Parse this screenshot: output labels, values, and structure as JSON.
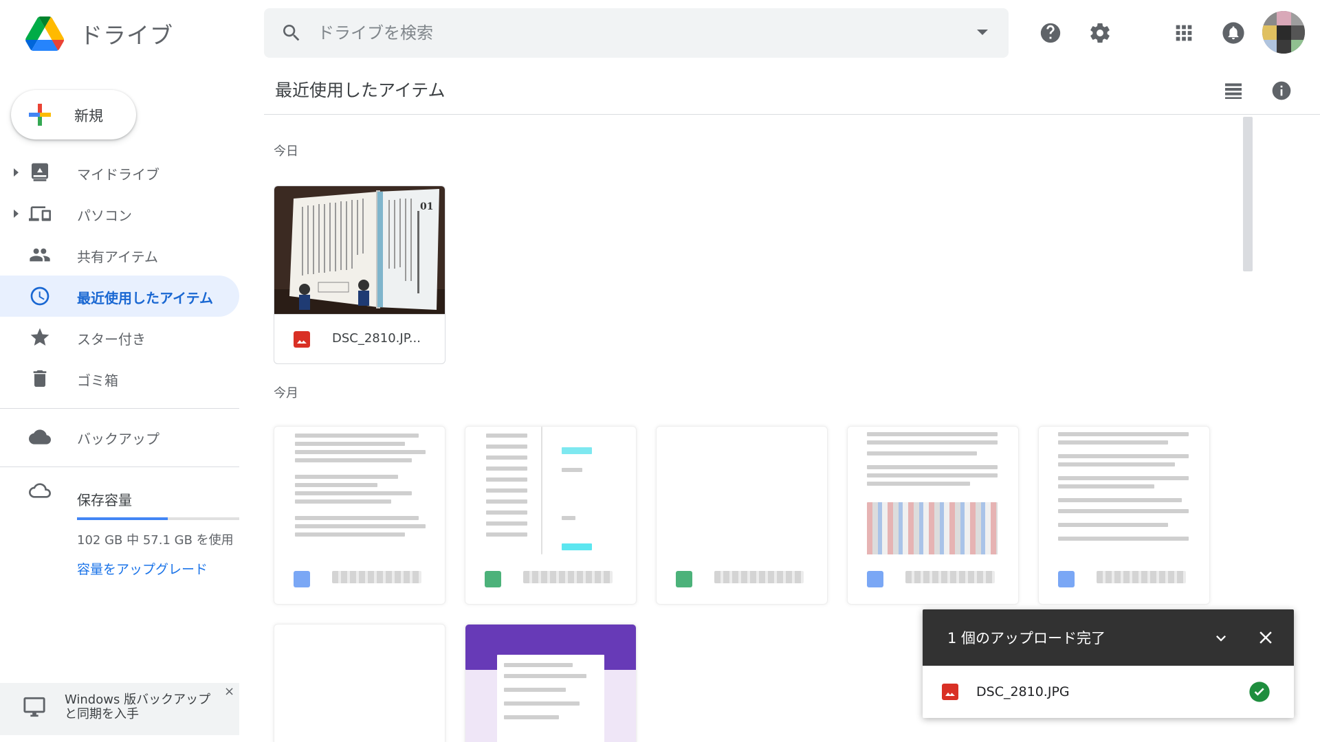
{
  "app": {
    "name": "ドライブ",
    "search_placeholder": "ドライブを検索"
  },
  "sidebar": {
    "new_label": "新規",
    "items": [
      {
        "label": "マイドライブ",
        "icon": "my-drive-icon",
        "expandable": true
      },
      {
        "label": "パソコン",
        "icon": "computers-icon",
        "expandable": true
      },
      {
        "label": "共有アイテム",
        "icon": "shared-people-icon"
      },
      {
        "label": "最近使用したアイテム",
        "icon": "clock-icon",
        "active": true
      },
      {
        "label": "スター付き",
        "icon": "star-icon"
      },
      {
        "label": "ゴミ箱",
        "icon": "trash-icon"
      }
    ],
    "backup_label": "バックアップ",
    "storage": {
      "label": "保存容量",
      "usage_text": "102 GB 中 57.1 GB を使用",
      "used_fraction": 0.56,
      "upgrade_label": "容量をアップグレード"
    },
    "promo": {
      "text": "Windows 版バックアップと同期を入手",
      "close": "×"
    }
  },
  "main": {
    "title": "最近使用したアイテム",
    "sections": {
      "today": "今日",
      "this_month": "今月"
    },
    "today_files": [
      {
        "name": "DSC_2810.JP...",
        "type": "image"
      }
    ]
  },
  "upload": {
    "title": "1 個のアップロード完了",
    "file_name": "DSC_2810.JPG"
  },
  "colors": {
    "accent": "#1967d2",
    "active_bg": "#e8f0fe",
    "image_file": "#d93025",
    "docs": "#4285f4",
    "sheets": "#0f9d58",
    "forms": "#673ab7",
    "success": "#1e8e3e"
  }
}
